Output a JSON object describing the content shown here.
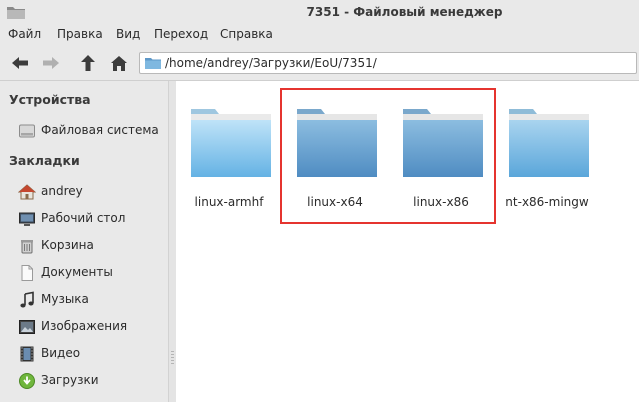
{
  "window": {
    "title": "7351 - Файловый менеджер"
  },
  "menu": [
    "Файл",
    "Правка",
    "Вид",
    "Переход",
    "Справка"
  ],
  "location": {
    "path": "/home/andrey/Загрузки/EoU/7351/"
  },
  "sidebar": {
    "devices_header": "Устройства",
    "devices": [
      {
        "label": "Файловая система",
        "icon": "drive-icon"
      }
    ],
    "bookmarks_header": "Закладки",
    "bookmarks": [
      {
        "label": "andrey",
        "icon": "home-icon"
      },
      {
        "label": "Рабочий стол",
        "icon": "desktop-icon"
      },
      {
        "label": "Корзина",
        "icon": "trash-icon"
      },
      {
        "label": "Документы",
        "icon": "document-icon"
      },
      {
        "label": "Музыка",
        "icon": "music-icon"
      },
      {
        "label": "Изображения",
        "icon": "image-icon"
      },
      {
        "label": "Видео",
        "icon": "video-icon"
      },
      {
        "label": "Загрузки",
        "icon": "download-icon"
      }
    ]
  },
  "folders": [
    {
      "name": "linux-armhf",
      "selected": false
    },
    {
      "name": "linux-x64",
      "selected": true
    },
    {
      "name": "linux-x86",
      "selected": true
    },
    {
      "name": "nt-x86-mingw",
      "selected": false
    }
  ],
  "colors": {
    "highlight_box": "#e5342f",
    "folder_light": "#7fc3ea",
    "folder_dark": "#5e98c8"
  }
}
